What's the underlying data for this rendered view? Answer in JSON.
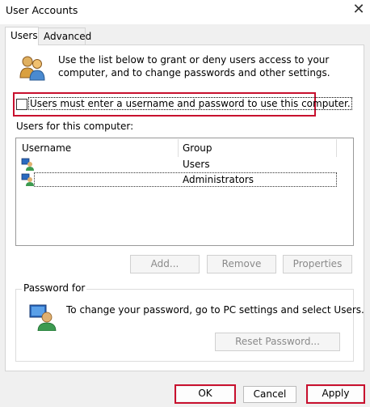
{
  "window": {
    "title": "User Accounts",
    "close_glyph": "✕"
  },
  "tabs": [
    {
      "label": "Users",
      "selected": true
    },
    {
      "label": "Advanced",
      "selected": false
    }
  ],
  "intro": {
    "text": "Use the list below to grant or deny users access to your computer, and to change passwords and other settings.",
    "icon": "users-icon"
  },
  "login_requirement": {
    "label": "Users must enter a username and password to use this computer.",
    "checked": false
  },
  "users_list": {
    "label": "Users for this computer:",
    "columns": [
      "Username",
      "Group"
    ],
    "rows": [
      {
        "username": "",
        "group": "Users",
        "icon": "user-icon"
      },
      {
        "username": "",
        "group": "Administrators",
        "icon": "user-icon",
        "selected": true
      }
    ]
  },
  "list_buttons": {
    "add": "Add...",
    "remove": "Remove",
    "properties": "Properties"
  },
  "password_section": {
    "label": "Password for",
    "text": "To change your password, go to PC settings and select Users.",
    "reset_button": "Reset Password...",
    "icon": "key-user-icon"
  },
  "footer": {
    "ok": "OK",
    "cancel": "Cancel",
    "apply": "Apply"
  },
  "colors": {
    "highlight": "#c8102e",
    "disabled_text": "#8a8a8a"
  }
}
